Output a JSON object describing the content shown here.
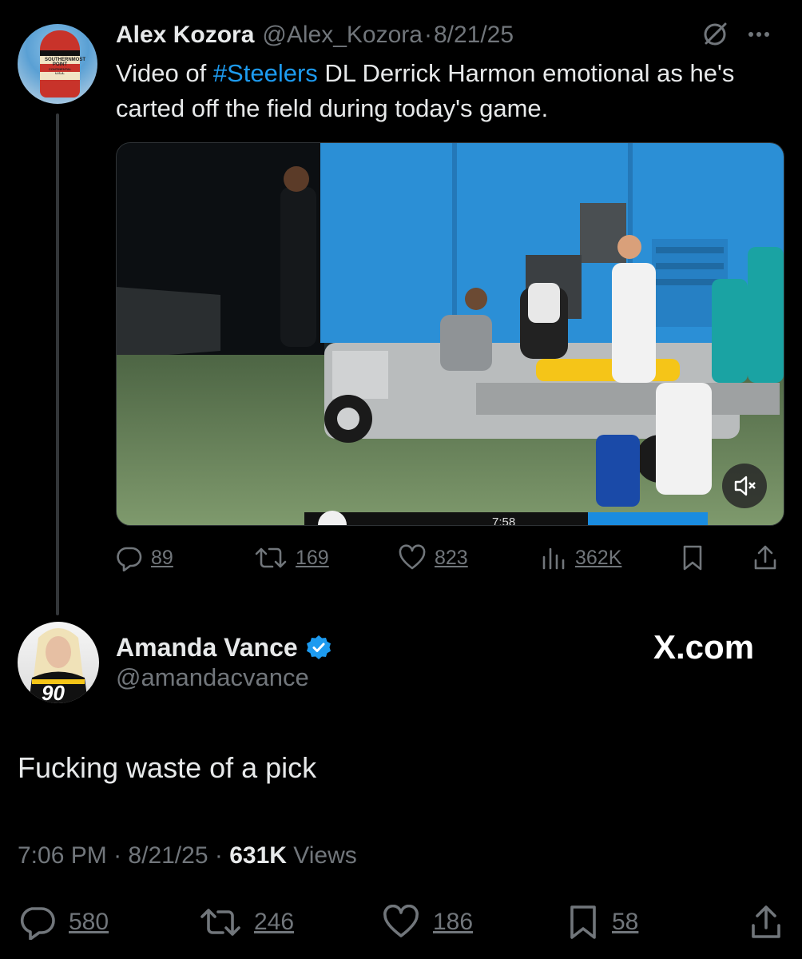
{
  "parent_tweet": {
    "author_name": "Alex Kozora",
    "author_handle": "@Alex_Kozora",
    "separator": "·",
    "date": "8/21/25",
    "text_before": "Video of ",
    "hashtag": "#Steelers",
    "text_after": " DL Derrick Harmon emotional as he's carted off the field during today's game.",
    "avatar_text": [
      "SOUTHERNMOST",
      "POINT",
      "CONTINENTAL U.S.A."
    ],
    "video": {
      "scoreboard_time": "7:58",
      "mute_icon": "volume-muted-icon"
    },
    "stats": {
      "replies": "89",
      "reposts": "169",
      "likes": "823",
      "views": "362K"
    }
  },
  "reply_tweet": {
    "author_name": "Amanda Vance",
    "verified": true,
    "author_handle": "@amandacvance",
    "avatar_jersey_number": "90",
    "watermark": "X.com",
    "text": "Fucking waste of a pick",
    "time": "7:06 PM",
    "date": "8/21/25",
    "separator": "·",
    "views_count": "631K",
    "views_label": "Views",
    "stats": {
      "replies": "580",
      "reposts": "246",
      "likes": "186",
      "bookmarks": "58"
    }
  },
  "colors": {
    "background": "#000000",
    "text": "#e7e9ea",
    "muted": "#71767b",
    "accent": "#1d9bf0",
    "thread_line": "#333639"
  }
}
